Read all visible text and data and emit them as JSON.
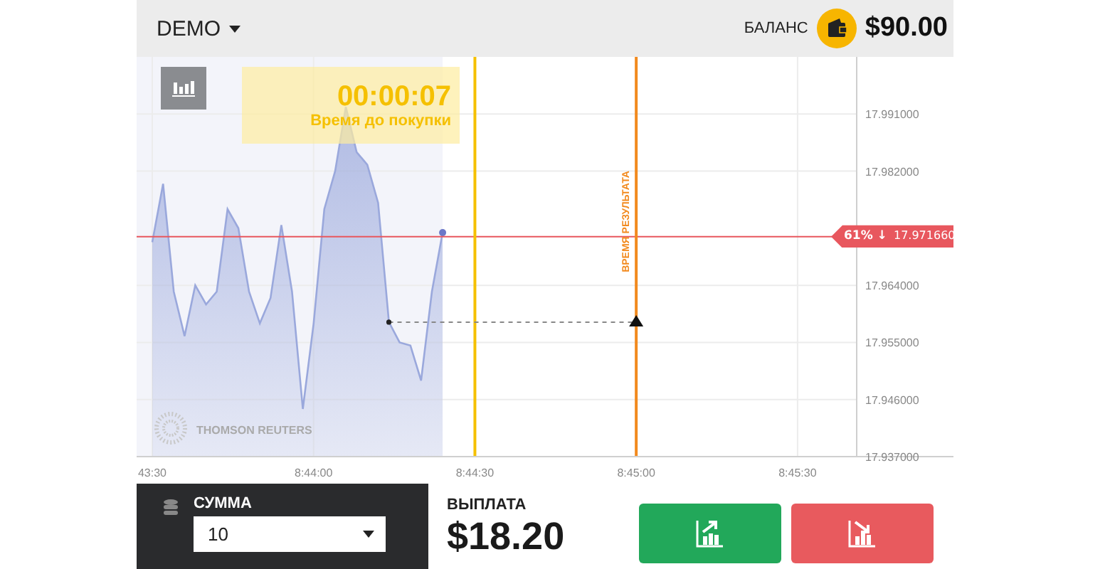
{
  "header": {
    "account": "DEMO",
    "balance_label": "БАЛАНС",
    "balance": "$90.00"
  },
  "chart": {
    "timer": {
      "time": "00:00:07",
      "caption": "Время до покупки"
    },
    "provider_logo": "THOMSON REUTERS",
    "markers": [
      {
        "kind": "vline",
        "color": "#f5c000"
      },
      {
        "kind": "vline",
        "label": "ВРЕМЯ РЕЗУЛЬТАТА",
        "color": "#f28a1e"
      },
      {
        "kind": "entry"
      }
    ],
    "chart_data": {
      "type": "area",
      "grid": true,
      "ylim": [
        17.937,
        18.0
      ],
      "categories": [
        "43:30",
        null,
        null,
        null,
        null,
        null,
        null,
        null,
        null,
        null,
        null,
        null,
        null,
        null,
        null,
        "8:44:00",
        null,
        null,
        null,
        null,
        null,
        null,
        null,
        null,
        null,
        null,
        null,
        null,
        null,
        null,
        "8:44:30",
        null,
        null,
        null,
        null,
        null,
        null,
        null,
        null,
        null,
        null,
        null,
        null,
        null,
        null,
        "8:45:00",
        null,
        null,
        null,
        null,
        null,
        null,
        null,
        null,
        null,
        null,
        null,
        null,
        null,
        null,
        "8:45:30",
        null,
        null,
        null,
        null,
        null
      ],
      "yticks": [
        {
          "value": 17.937,
          "label": "17.937000"
        },
        {
          "value": 17.946,
          "label": "17.946000"
        },
        {
          "value": 17.955,
          "label": "17.955000"
        },
        {
          "value": 17.964,
          "label": "17.964000"
        },
        {
          "value": 17.982,
          "label": "17.982000"
        },
        {
          "value": 17.991,
          "label": "17.991000"
        }
      ],
      "series": [
        {
          "color": "#9aa8dc",
          "values": [
            17.9708,
            17.98,
            17.963,
            17.956,
            17.964,
            17.961,
            17.963,
            17.976,
            17.973,
            17.963,
            17.958,
            17.962,
            17.9735,
            17.963,
            17.9445,
            17.958,
            17.976,
            17.982,
            17.9921,
            17.985,
            17.983,
            17.977,
            17.9582,
            17.955,
            17.9545,
            17.949,
            17.963,
            17.9723,
            null,
            null,
            null,
            null,
            null,
            null,
            null,
            null,
            null,
            null,
            null,
            null,
            null,
            null,
            null,
            null,
            null,
            null,
            null,
            null,
            null,
            null,
            null,
            null,
            null,
            null,
            null,
            null,
            null,
            null,
            null,
            null,
            null,
            null,
            null,
            null,
            null,
            null
          ]
        }
      ],
      "ref_lines": [
        {
          "axis": "y",
          "value": 17.97166,
          "label": "**61% ↓** 17.971660",
          "color": "#e8575e"
        }
      ]
    }
  },
  "amount": {
    "label": "СУММА",
    "value": "10"
  },
  "payout": {
    "label": "ВЫПЛАТА",
    "value": "$18.20"
  },
  "trade_buttons": [
    {
      "kind": "up"
    },
    {
      "kind": "down"
    }
  ]
}
